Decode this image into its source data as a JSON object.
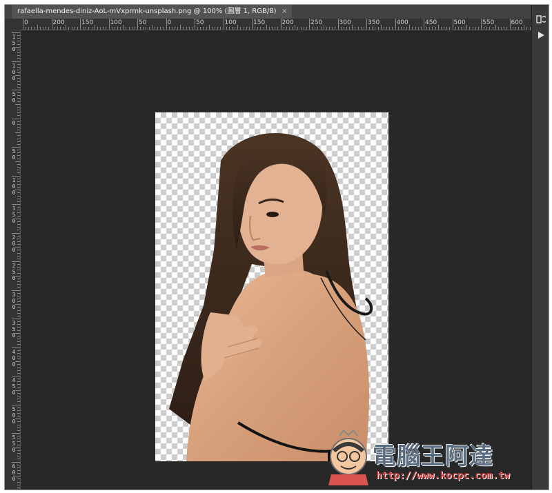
{
  "document_tab": {
    "title": "rafaella-mendes-diniz-AoL-mVxprmk-unsplash.png @ 100% (圖層 1, RGB/8)",
    "close_label": "×"
  },
  "ruler": {
    "horizontal_labels": [
      "0",
      "200",
      "150",
      "100",
      "50",
      "0",
      "50",
      "100",
      "150",
      "200",
      "250",
      "300",
      "350",
      "400",
      "450",
      "500",
      "550",
      "600"
    ],
    "vertical_labels": [
      "150",
      "100",
      "50",
      "0",
      "50",
      "100",
      "150",
      "200",
      "250",
      "300",
      "350",
      "400",
      "450",
      "500",
      "550",
      "600"
    ]
  },
  "right_panel": {
    "icons": [
      "history-panel-icon",
      "play-action-icon"
    ]
  },
  "colors": {
    "canvas_bg": "#282828",
    "ruler_bg": "#333333",
    "tab_active": "#535353",
    "panel_bg": "#3a3a3a"
  },
  "watermark": {
    "title": "電腦王阿達",
    "url": "http://www.kocpc.com.tw"
  }
}
